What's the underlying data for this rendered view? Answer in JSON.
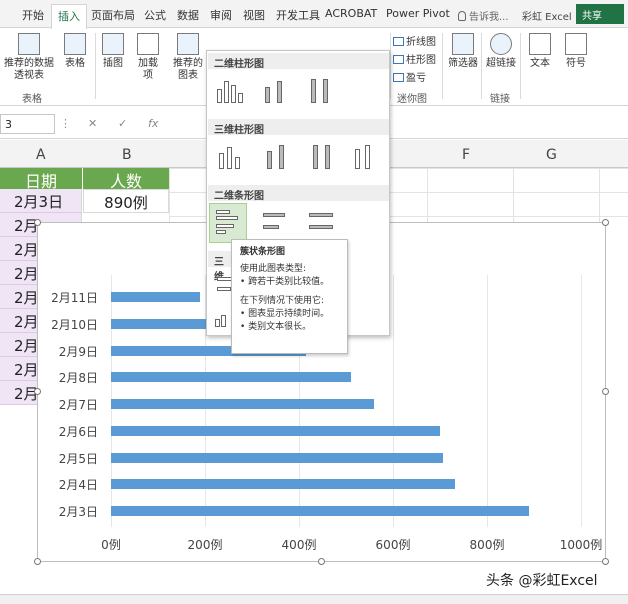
{
  "tabs": [
    "开始",
    "插入",
    "页面布局",
    "公式",
    "数据",
    "审阅",
    "视图",
    "开发工具",
    "ACROBAT",
    "Power Pivot"
  ],
  "active_tab": "插入",
  "tell_me": "告诉我...",
  "user": "彩虹 Excel",
  "share": "共享",
  "ribbon": {
    "pivot": "推荐的数据透视表",
    "table": "表格",
    "illustrations": "插图",
    "addins": "加载项",
    "rec_charts": "推荐的图表",
    "group_tables": "表格",
    "spark_line": "折线图",
    "spark_column": "柱形图",
    "spark_winloss": "盈亏",
    "group_sparklines": "迷你图",
    "slicer": "筛选器",
    "hyperlink": "超链接",
    "group_links": "链接",
    "text": "文本",
    "symbol": "符号"
  },
  "namebox": "3",
  "columns": [
    "A",
    "B",
    "F",
    "G"
  ],
  "table": {
    "header_date": "日期",
    "header_count": "人数",
    "row_date": "2月3日",
    "row_count": "890例",
    "partial_rows": [
      "2月",
      "2月",
      "2月",
      "2月",
      "2月",
      "2月",
      "2月",
      "2月"
    ]
  },
  "dropdown": {
    "sections": [
      "二维柱形图",
      "三维柱形图",
      "二维条形图",
      "三维"
    ],
    "hover_item": "簇状条形图"
  },
  "tooltip": {
    "title": "簇状条形图",
    "line1": "使用此图表类型:",
    "line2": "• 跨若干类别比较值。",
    "line3": "在下列情况下使用它:",
    "line4": "• 图表显示持续时间。",
    "line5": "• 类别文本很长。"
  },
  "chart_data": {
    "type": "bar",
    "orientation": "horizontal",
    "categories": [
      "2月3日",
      "2月4日",
      "2月5日",
      "2月6日",
      "2月7日",
      "2月8日",
      "2月9日",
      "2月10日",
      "2月11日"
    ],
    "values": [
      890,
      731,
      707,
      700,
      559,
      511,
      414,
      290,
      190
    ],
    "xlim": [
      0,
      1000
    ],
    "tick_labels": [
      "0例",
      "200例",
      "400例",
      "600例",
      "800例",
      "1000例"
    ],
    "color": "#5b9bd5",
    "grid": true
  },
  "watermark": "头条 @彩虹Excel"
}
